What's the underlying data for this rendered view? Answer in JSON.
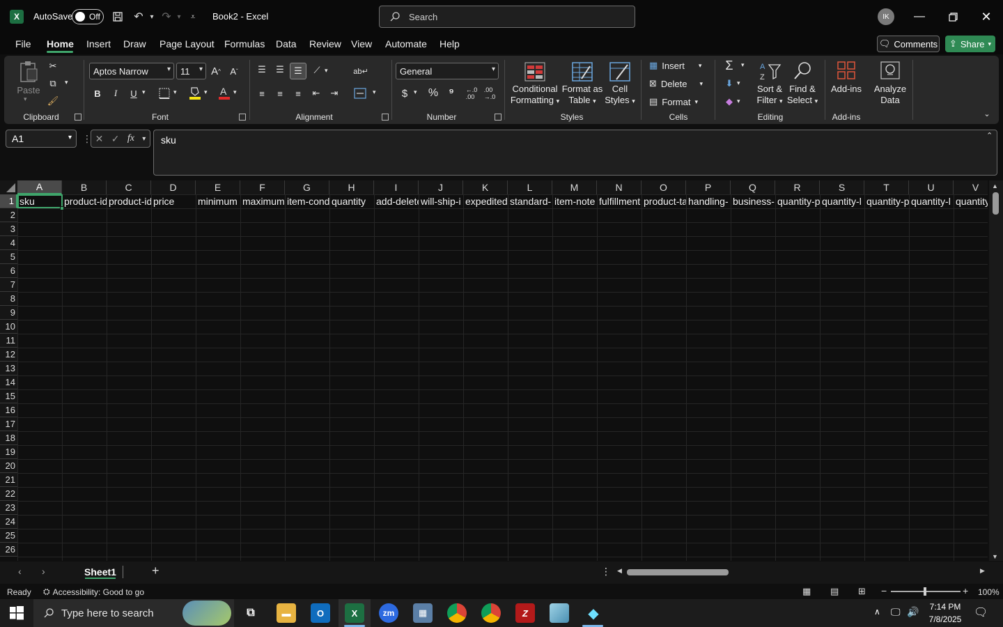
{
  "titlebar": {
    "autosave_label": "AutoSave",
    "autosave_state": "Off",
    "doc_title": "Book2  -  Excel",
    "search_placeholder": "Search",
    "avatar_initials": "IK"
  },
  "tabs": [
    "File",
    "Home",
    "Insert",
    "Draw",
    "Page Layout",
    "Formulas",
    "Data",
    "Review",
    "View",
    "Automate",
    "Help"
  ],
  "active_tab": "Home",
  "actions": {
    "comments": "Comments",
    "share": "Share"
  },
  "ribbon": {
    "clipboard": {
      "label": "Clipboard",
      "paste": "Paste"
    },
    "font": {
      "label": "Font",
      "font_name": "Aptos Narrow",
      "font_size": "11",
      "bold": "B",
      "italic": "I",
      "underline": "U"
    },
    "alignment": {
      "label": "Alignment"
    },
    "number": {
      "label": "Number",
      "format": "General"
    },
    "styles": {
      "label": "Styles",
      "conditional": "Conditional",
      "conditional2": "Formatting",
      "format_as": "Format as",
      "format_as2": "Table",
      "cell": "Cell",
      "cell2": "Styles"
    },
    "cells": {
      "label": "Cells",
      "insert": "Insert",
      "delete": "Delete",
      "format": "Format"
    },
    "editing": {
      "label": "Editing",
      "sort": "Sort &",
      "sort2": "Filter",
      "find": "Find &",
      "find2": "Select"
    },
    "addins": {
      "label": "Add-ins",
      "addins_btn": "Add-ins",
      "analyze": "Analyze",
      "analyze2": "Data"
    }
  },
  "formula_bar": {
    "name_box": "A1",
    "content": "sku"
  },
  "grid": {
    "columns": [
      "A",
      "B",
      "C",
      "D",
      "E",
      "F",
      "G",
      "H",
      "I",
      "J",
      "K",
      "L",
      "M",
      "N",
      "O",
      "P",
      "Q",
      "R",
      "S",
      "T",
      "U",
      "V"
    ],
    "rows": [
      "1",
      "2",
      "3",
      "4",
      "5",
      "6",
      "7",
      "8",
      "9",
      "10",
      "11",
      "12",
      "13",
      "14",
      "15",
      "16",
      "17",
      "18",
      "19",
      "20",
      "21",
      "22",
      "23",
      "24",
      "25",
      "26"
    ],
    "row1": [
      "sku",
      "product-id",
      "product-id",
      "price",
      "minimum",
      "maximum",
      "item-cond",
      "quantity",
      "add-delete",
      "will-ship-i",
      "expedited-",
      "standard-",
      "item-note",
      "fulfillment",
      "product-ta",
      "handling-",
      "business-",
      "quantity-p",
      "quantity-l",
      "quantity-p",
      "quantity-l",
      "quantity-"
    ]
  },
  "sheets": {
    "active": "Sheet1"
  },
  "status": {
    "ready": "Ready",
    "accessibility": "Accessibility: Good to go",
    "zoom": "100%"
  },
  "taskbar": {
    "search_placeholder": "Type here to search",
    "time": "7:14 PM",
    "date": "7/8/2025"
  }
}
